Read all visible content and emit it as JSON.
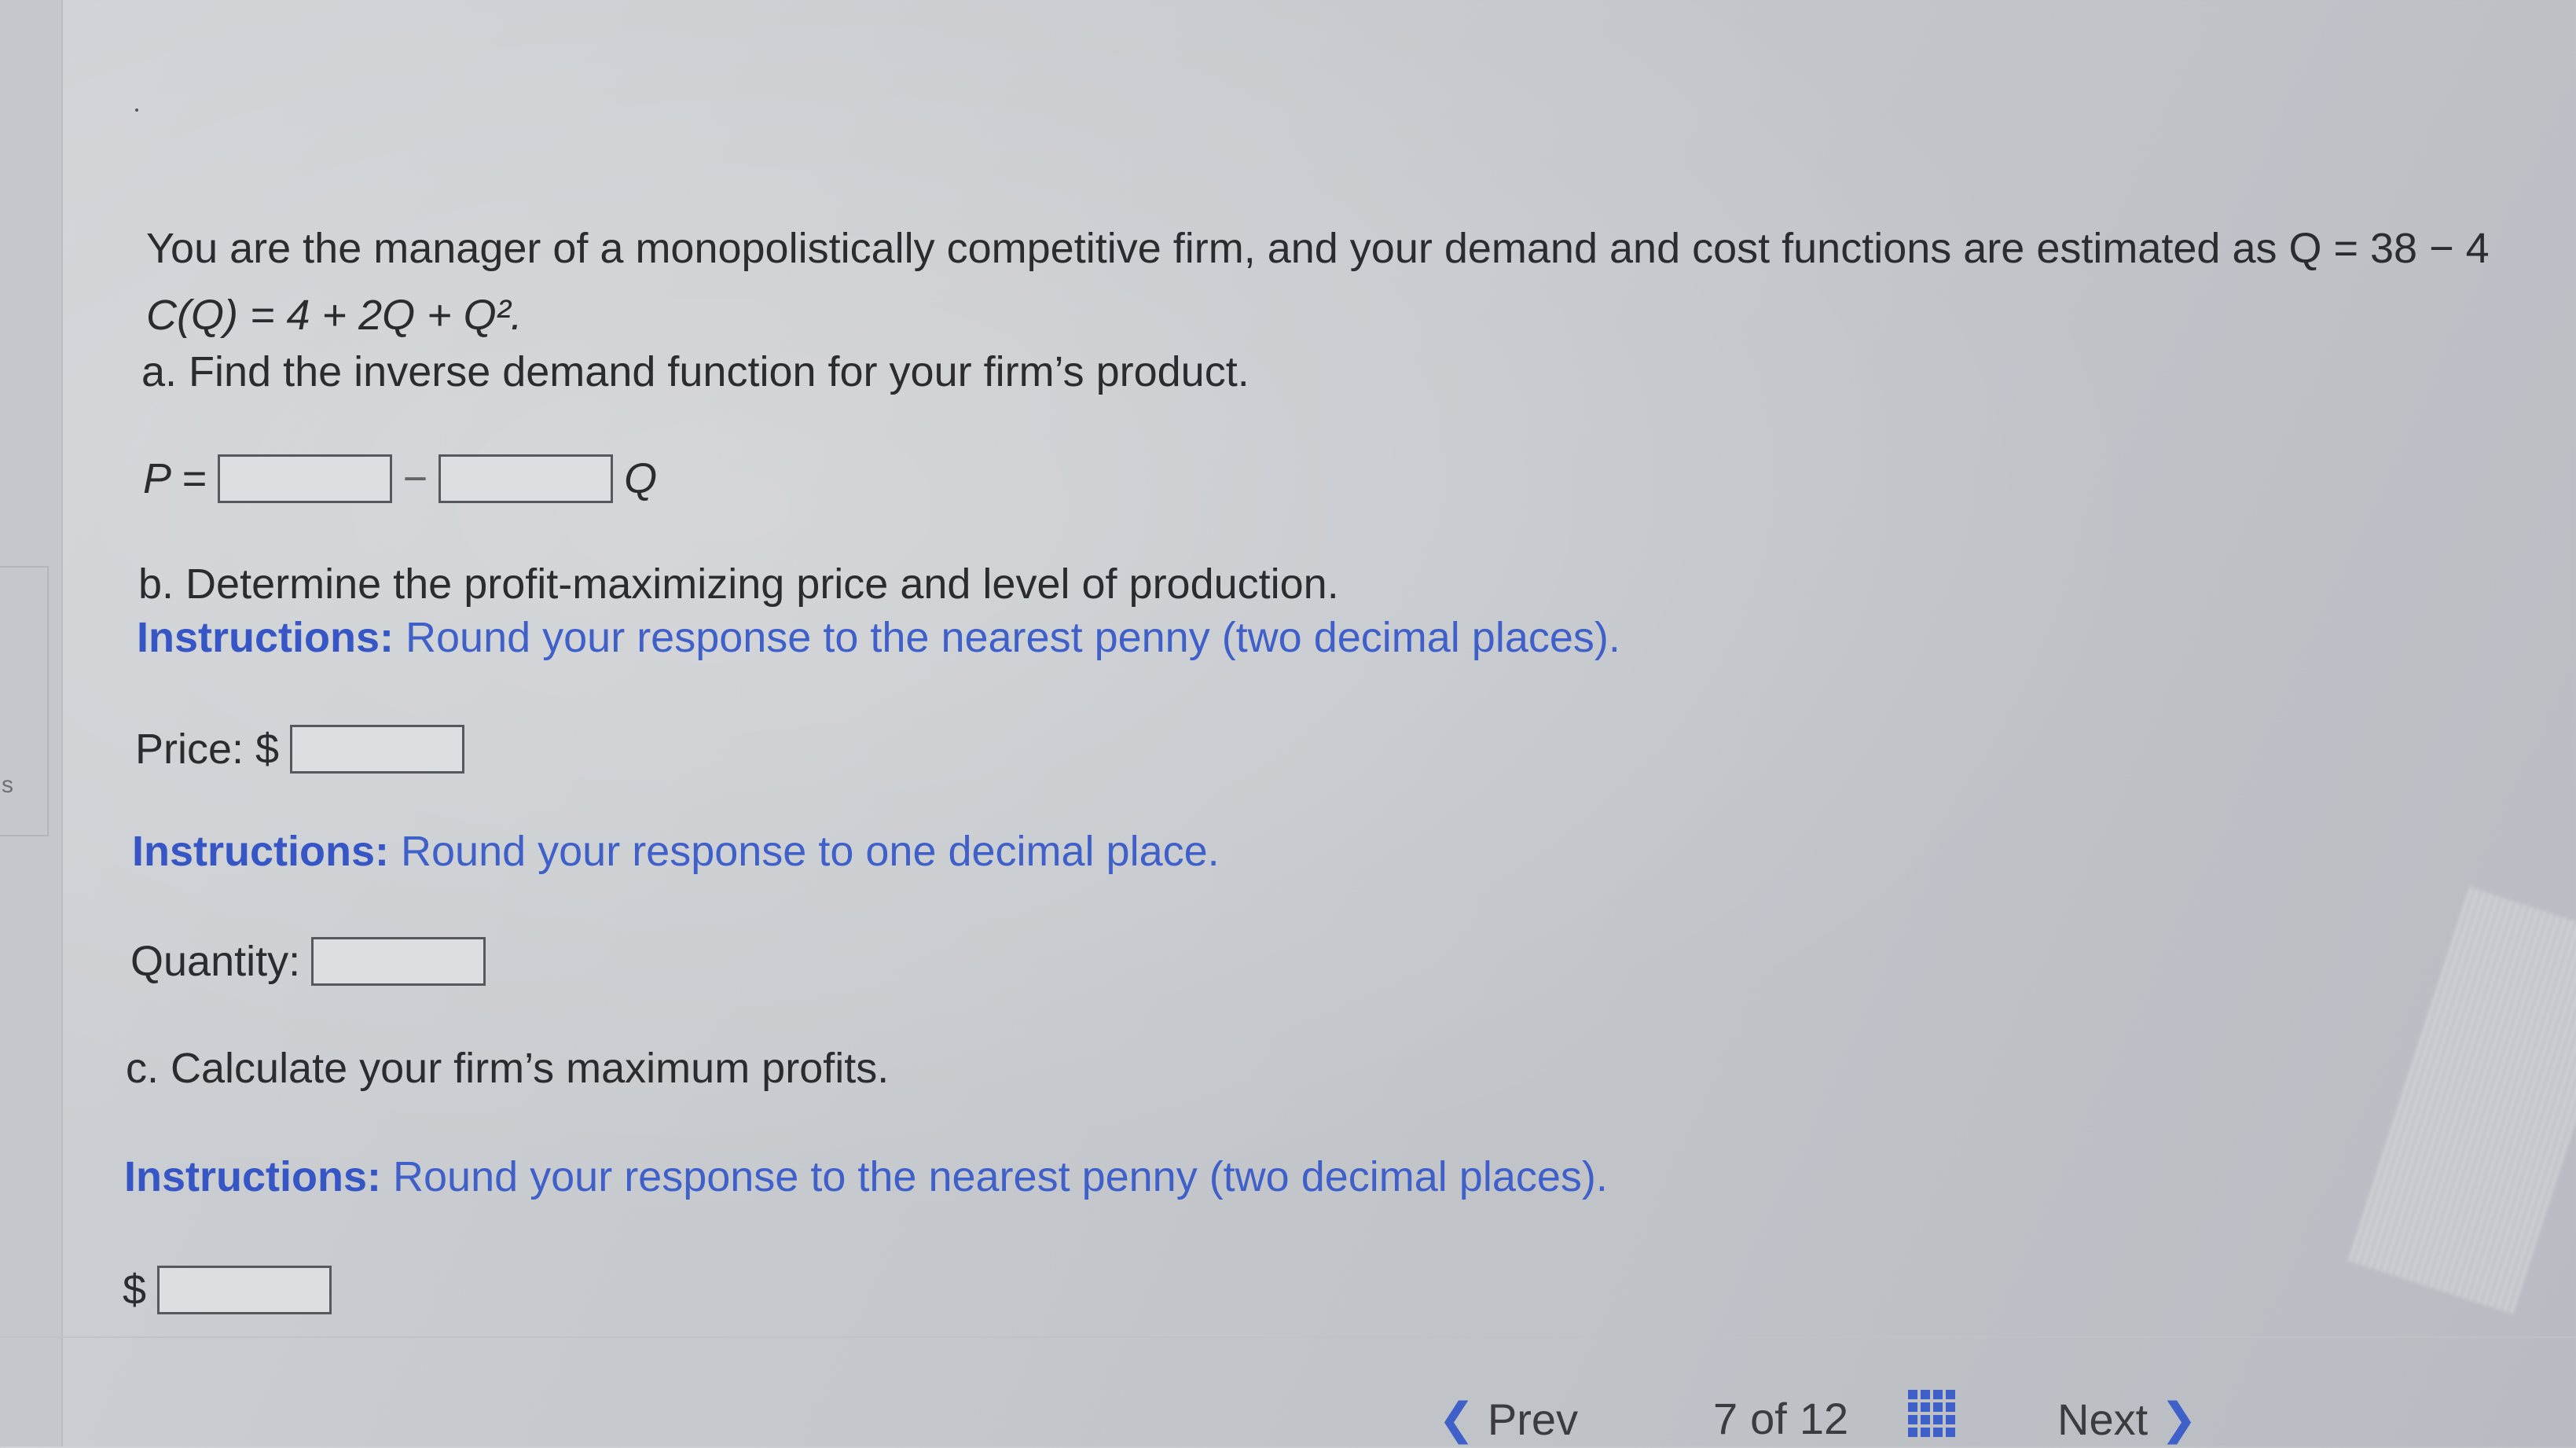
{
  "question": {
    "intro_line1": "You are the manager of a monopolistically competitive firm, and your demand and cost functions are estimated as Q = 38 − 4",
    "intro_line2": "C(Q) = 4 + 2Q + Q².",
    "part_a": "a. Find the inverse demand function for your firm’s product.",
    "p_label": "P =",
    "minus_sign": "−",
    "q_suffix": "Q",
    "part_b": "b. Determine the profit-maximizing price and level of production.",
    "instr_b_lead": "Instructions:",
    "instr_b_text": " Round your response to the nearest penny (two decimal places).",
    "price_label": "Price: $",
    "instr_qty_lead": "Instructions:",
    "instr_qty_text": " Round your response to one decimal place.",
    "quantity_label": "Quantity:",
    "part_c": "c. Calculate your firm’s maximum profits.",
    "instr_c_lead": "Instructions:",
    "instr_c_text": " Round your response to the nearest penny (two decimal places).",
    "profit_label": "$"
  },
  "side_rail": {
    "letter": "s"
  },
  "navigation": {
    "prev_label": "Prev",
    "page_current": "7",
    "page_of": "of",
    "page_total": "12",
    "next_label": "Next"
  },
  "colors": {
    "instruction_blue": "#3f5fc9",
    "text_dark": "#2a2c30"
  }
}
